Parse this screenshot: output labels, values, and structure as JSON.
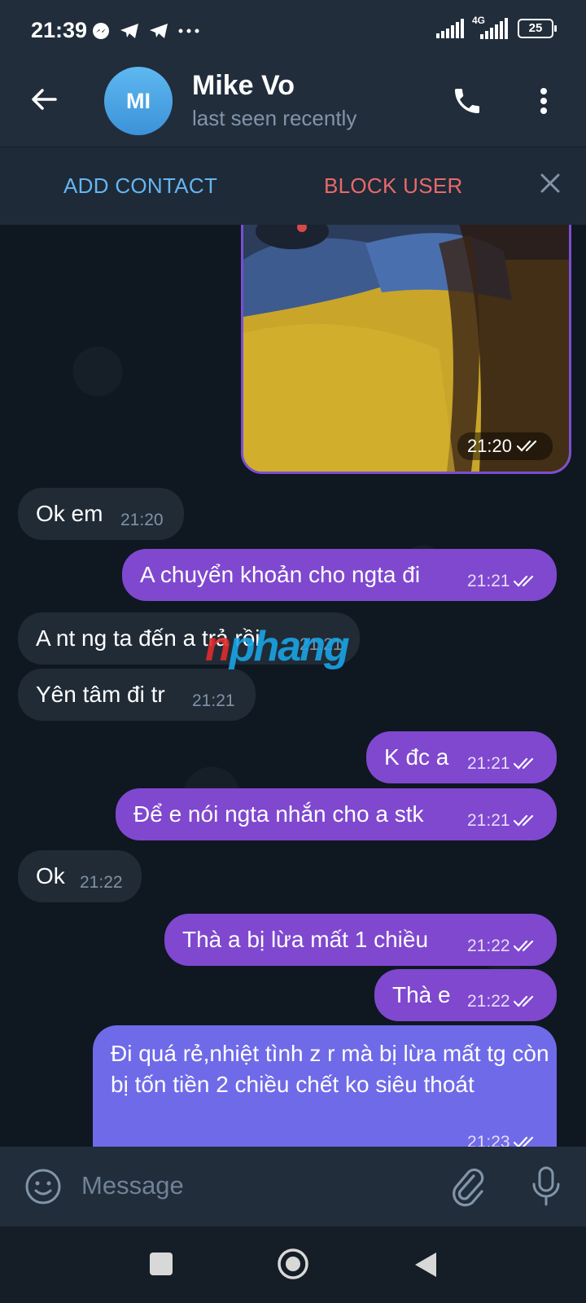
{
  "status": {
    "time": "21:39",
    "network": "4G",
    "battery": "25",
    "icons": [
      "messenger-icon",
      "telegram-icon",
      "telegram-icon",
      "more-dots-icon"
    ]
  },
  "header": {
    "avatar_initials": "MI",
    "title": "Mike Vo",
    "subtitle": "last seen recently"
  },
  "actions": {
    "add_contact": "ADD CONTACT",
    "block_user": "BLOCK USER"
  },
  "photo": {
    "time": "21:20"
  },
  "messages": [
    {
      "dir": "in",
      "text": "Ok em",
      "time": "21:20"
    },
    {
      "dir": "out",
      "text": "A chuyển khoản cho ngta đi",
      "time": "21:21"
    },
    {
      "dir": "in",
      "text": "A nt ng ta đến a trả rồi",
      "time": "21:21"
    },
    {
      "dir": "in",
      "text": "Yên tâm đi tr",
      "time": "21:21"
    },
    {
      "dir": "out",
      "text": "K đc a",
      "time": "21:21"
    },
    {
      "dir": "out",
      "text": "Để e nói ngta nhắn cho a stk",
      "time": "21:21"
    },
    {
      "dir": "in",
      "text": "Ok",
      "time": "21:22"
    },
    {
      "dir": "out",
      "text": "Thà a bị lừa mất 1 chiều",
      "time": "21:22"
    },
    {
      "dir": "out",
      "text": "Thà e",
      "time": "21:22"
    },
    {
      "dir": "out",
      "text": "Đi quá rẻ,nhiệt tình z r mà bị lừa mất tg còn bị tốn tiền 2 chiều chết ko siêu thoát",
      "time": "21:23"
    }
  ],
  "input": {
    "placeholder": "Message"
  },
  "watermark": {
    "prefix": "n",
    "text": "phang"
  },
  "colors": {
    "outgoing_bubble": "#7f48cf",
    "incoming_bubble": "#202b36",
    "add_contact": "#65b5f2",
    "block_user": "#e86a6a"
  }
}
